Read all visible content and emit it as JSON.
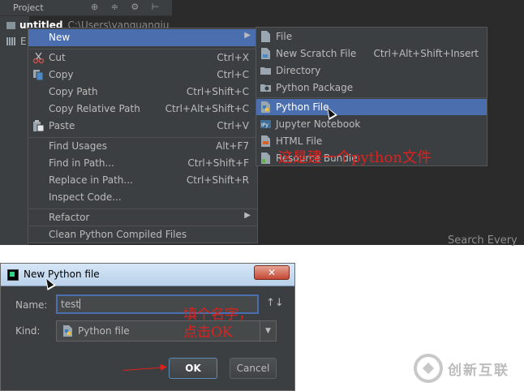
{
  "project_panel": {
    "title": "Project",
    "toolbar_glyphs": "⊕ ≑ ⚙ ⊢",
    "tree_root": "untitled",
    "tree_root_path": "C:\\Users\\yanguangju",
    "tree_second": "E"
  },
  "context_menu": {
    "items": [
      {
        "label": "New",
        "shortcut": "",
        "submenu": true
      },
      {
        "label": "Cut",
        "shortcut": "Ctrl+X"
      },
      {
        "label": "Copy",
        "shortcut": "Ctrl+C"
      },
      {
        "label": "Copy Path",
        "shortcut": "Ctrl+Shift+C"
      },
      {
        "label": "Copy Relative Path",
        "shortcut": "Ctrl+Alt+Shift+C"
      },
      {
        "label": "Paste",
        "shortcut": "Ctrl+V"
      },
      {
        "label": "Find Usages",
        "shortcut": "Alt+F7"
      },
      {
        "label": "Find in Path...",
        "shortcut": "Ctrl+Shift+F"
      },
      {
        "label": "Replace in Path...",
        "shortcut": "Ctrl+Shift+R"
      },
      {
        "label": "Inspect Code...",
        "shortcut": ""
      },
      {
        "label": "Refactor",
        "shortcut": "",
        "submenu": true
      },
      {
        "label": "Clean Python Compiled Files",
        "shortcut": ""
      }
    ]
  },
  "new_submenu": {
    "items": [
      {
        "label": "File",
        "shortcut": ""
      },
      {
        "label": "New Scratch File",
        "shortcut": "Ctrl+Alt+Shift+Insert"
      },
      {
        "label": "Directory",
        "shortcut": ""
      },
      {
        "label": "Python Package",
        "shortcut": ""
      },
      {
        "label": "Python File",
        "shortcut": ""
      },
      {
        "label": "Jupyter Notebook",
        "shortcut": ""
      },
      {
        "label": "HTML File",
        "shortcut": ""
      },
      {
        "label": "Resource Bundle",
        "shortcut": ""
      }
    ]
  },
  "annotations": {
    "submenu_note": "这是建一个python文件",
    "dialog_note_line1": "填个名字，",
    "dialog_note_line2": "点击OK"
  },
  "search_hint": "Search Every",
  "dialog": {
    "title": "New Python file",
    "close_glyph": "✕",
    "name_label": "Name:",
    "name_value": "test",
    "sort_glyph": "↑↓",
    "kind_label": "Kind:",
    "kind_value": "Python file",
    "ok_label": "OK",
    "cancel_label": "Cancel"
  },
  "watermark": {
    "text": "创新互联"
  },
  "colors": {
    "highlight": "#4b6eaf",
    "menu_bg": "#3c3f41",
    "editor_bg": "#2b2b2b",
    "annotation": "#e0201c"
  }
}
